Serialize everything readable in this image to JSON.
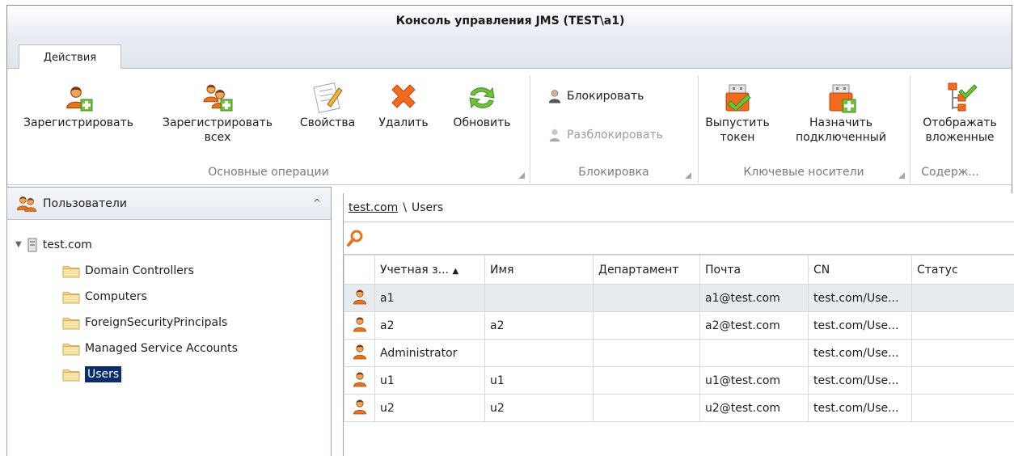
{
  "window": {
    "title": "Консоль управления JMS (TEST\\a1)"
  },
  "tabs": [
    {
      "label": "Действия"
    }
  ],
  "ribbon": {
    "groups": [
      {
        "caption": "Основные операции",
        "buttons": [
          {
            "label": "Зарегистрировать",
            "icon": "user-add-icon"
          },
          {
            "label": "Зарегистрировать всех",
            "icon": "users-add-icon"
          },
          {
            "label": "Свойства",
            "icon": "properties-icon"
          },
          {
            "label": "Удалить",
            "icon": "delete-icon"
          },
          {
            "label": "Обновить",
            "icon": "refresh-icon"
          }
        ]
      },
      {
        "caption": "Блокировка",
        "buttons": [
          {
            "label": "Блокировать",
            "icon": "lock-user-icon",
            "enabled": true
          },
          {
            "label": "Разблокировать",
            "icon": "unlock-user-icon",
            "enabled": false
          }
        ]
      },
      {
        "caption": "Ключевые носители",
        "buttons": [
          {
            "label": "Выпустить токен",
            "icon": "issue-token-icon"
          },
          {
            "label": "Назначить подключенный",
            "icon": "assign-token-icon"
          }
        ]
      },
      {
        "caption": "Содерж...",
        "buttons": [
          {
            "label": "Отображать вложенные",
            "icon": "show-nested-icon"
          }
        ]
      }
    ]
  },
  "left_panel": {
    "title": "Пользователи",
    "tree": {
      "root": "test.com",
      "children": [
        "Domain Controllers",
        "Computers",
        "ForeignSecurityPrincipals",
        "Managed Service Accounts",
        "Users"
      ],
      "selected": "Users"
    }
  },
  "right_panel": {
    "breadcrumb": {
      "link": "test.com",
      "separator": "\\",
      "current": "Users"
    },
    "table": {
      "columns": [
        "Учетная з...",
        "Имя",
        "Департамент",
        "Почта",
        "CN",
        "Статус"
      ],
      "sort_indicator": "▲",
      "rows": [
        {
          "account": "a1",
          "name": "",
          "department": "",
          "mail": "a1@test.com",
          "cn": "test.com/Use...",
          "status": ""
        },
        {
          "account": "a2",
          "name": "a2",
          "department": "",
          "mail": "a2@test.com",
          "cn": "test.com/Use...",
          "status": ""
        },
        {
          "account": "Administrator",
          "name": "",
          "department": "",
          "mail": "",
          "cn": "test.com/Use...",
          "status": ""
        },
        {
          "account": "u1",
          "name": "u1",
          "department": "",
          "mail": "u1@test.com",
          "cn": "test.com/Use...",
          "status": ""
        },
        {
          "account": "u2",
          "name": "u2",
          "department": "",
          "mail": "u2@test.com",
          "cn": "test.com/Use...",
          "status": ""
        }
      ]
    }
  },
  "colors": {
    "selection": "#0b2d6e",
    "accent_orange": "#f07a1a",
    "accent_green": "#5cb82e",
    "delete_red": "#f06a1e"
  }
}
